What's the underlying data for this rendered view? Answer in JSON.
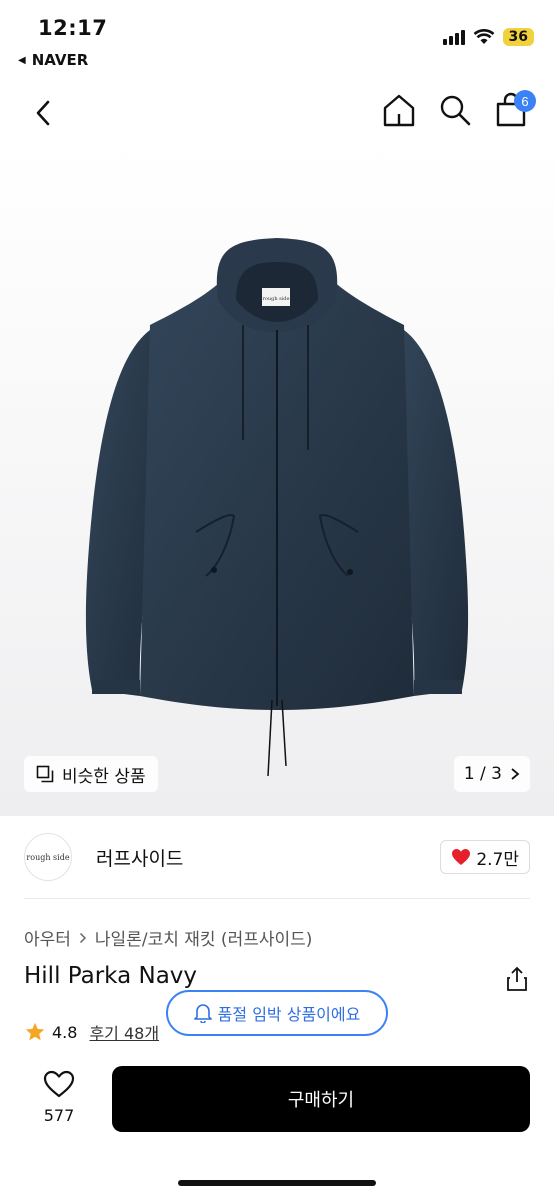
{
  "status": {
    "time": "12:17",
    "back_app": "NAVER",
    "battery": "36"
  },
  "nav": {
    "cart_count": "6"
  },
  "gallery": {
    "similar_label": "비슷한 상품",
    "pager": "1 / 3"
  },
  "jacket_label": "rough side",
  "seller": {
    "logo_text": "rough side",
    "name": "러프사이드",
    "likes": "2.7만"
  },
  "product": {
    "breadcrumb_1": "아우터",
    "breadcrumb_2": "나일론/코치 재킷 (러프사이드)",
    "title": "Hill Parka Navy",
    "rating": "4.8",
    "reviews": "후기 48개"
  },
  "toast": {
    "text": "품절 임박 상품이에요"
  },
  "bottom": {
    "wish_count": "577",
    "buy_label": "구매하기"
  },
  "colors": {
    "accent": "#3b82f6",
    "like_heart": "#e5202a",
    "star": "#f5a623",
    "jacket": "#2b3a4a"
  }
}
